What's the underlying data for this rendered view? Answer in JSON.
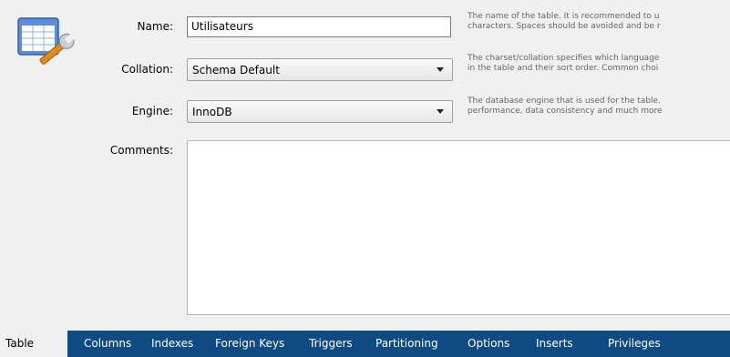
{
  "form": {
    "name_label": "Name:",
    "name_value": "Utilisateurs",
    "name_help_1": "The name of the table. It is recommended to u",
    "name_help_2": "characters. Spaces should be avoided and be r",
    "collation_label": "Collation:",
    "collation_value": "Schema Default",
    "collation_help_1": "The charset/collation specifies which language",
    "collation_help_2": "in the table and their sort order. Common choi",
    "engine_label": "Engine:",
    "engine_value": "InnoDB",
    "engine_help_1": "The database engine that is used for the table.",
    "engine_help_2": "performance, data consistency and much more",
    "comments_label": "Comments:",
    "comments_value": ""
  },
  "tabs": [
    {
      "label": "Table",
      "active": true
    },
    {
      "label": "Columns"
    },
    {
      "label": "Indexes"
    },
    {
      "label": "Foreign Keys"
    },
    {
      "label": "Triggers"
    },
    {
      "label": "Partitioning"
    },
    {
      "label": "Options"
    },
    {
      "label": "Inserts"
    },
    {
      "label": "Privileges"
    }
  ],
  "colors": {
    "tabbar": "#0f4a82",
    "background": "#f0f0f0"
  }
}
